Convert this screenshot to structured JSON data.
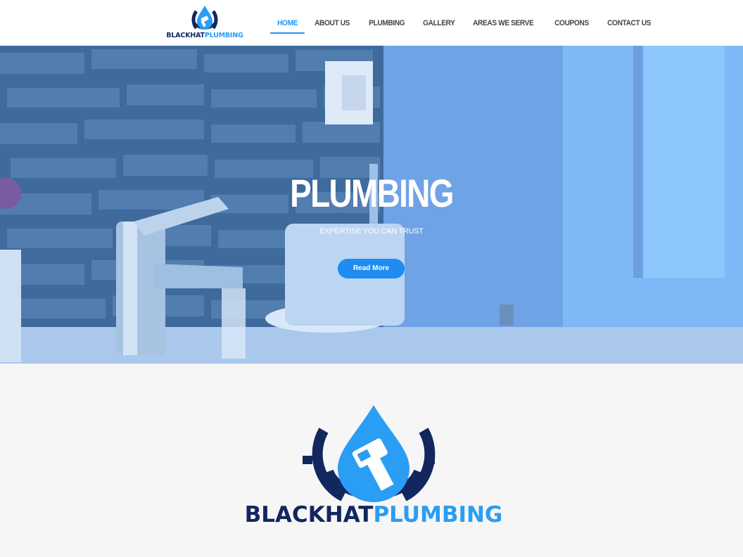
{
  "brand": {
    "part1": "BLACKHAT",
    "part2": "PLUMBING"
  },
  "nav": {
    "items": [
      {
        "label": "HOME",
        "active": true
      },
      {
        "label": "ABOUT US",
        "active": false
      },
      {
        "label": "PLUMBING",
        "active": false
      },
      {
        "label": "GALLERY",
        "active": false
      },
      {
        "label": "AREAS WE SERVE",
        "active": false
      },
      {
        "label": "COUPONS",
        "active": false
      },
      {
        "label": "CONTACT US",
        "active": false
      }
    ]
  },
  "hero": {
    "title": "PLUMBING",
    "subtitle": "EXPERTISE YOU CAN TRUST",
    "button_label": "Read More"
  },
  "colors": {
    "accent": "#2196f3",
    "button": "#1e8cf0",
    "navy": "#12275e",
    "sky": "#2a9df4",
    "page_bg": "#f6f6f6"
  },
  "icons": [
    "water-drop-wrench-logo-icon"
  ]
}
